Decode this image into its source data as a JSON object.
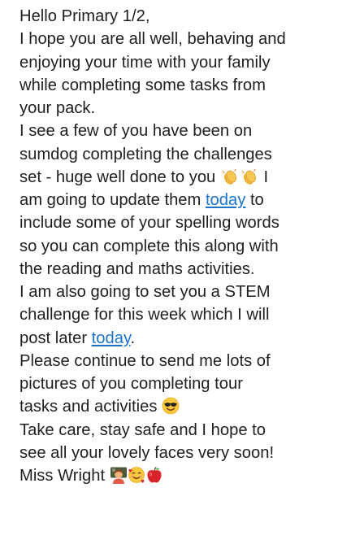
{
  "message": {
    "line1": "Hello Primary 1/2,",
    "line2": "I hope you are all well, behaving and",
    "line3": "enjoying your time with your family",
    "line4": "while completing some tasks from",
    "line5": "your pack.",
    "line6": "I see a few of you have been on",
    "line7": "sumdog completing the challenges",
    "line8_a": "set - huge well done to you ",
    "line8_b": " I",
    "line9_a": "am going to update them ",
    "line9_link": "today",
    "line9_b": " to",
    "line10": "include some of your spelling words",
    "line11": "so you can complete this along with",
    "line12": "the reading and maths activities.",
    "line13": "I am also going to set you a STEM",
    "line14": "challenge for this week which I will",
    "line15_a": "post later ",
    "line15_link": "today",
    "line15_b": ".",
    "line16": "Please continue to send me lots of",
    "line17": "pictures of you completing tour",
    "line18_a": "tasks and activities ",
    "line19": "Take care, stay safe and I hope to",
    "line20": "see all your lovely faces very soon!",
    "line21_a": "Miss Wright "
  },
  "emojis": [
    "clapping-hands",
    "clapping-hands",
    "smiling-face-with-sunglasses",
    "teacher",
    "smiling-face-with-hearts",
    "red-apple"
  ],
  "colors": {
    "text": "#1f1f1f",
    "link": "#1a73c8",
    "background": "#ffffff"
  }
}
